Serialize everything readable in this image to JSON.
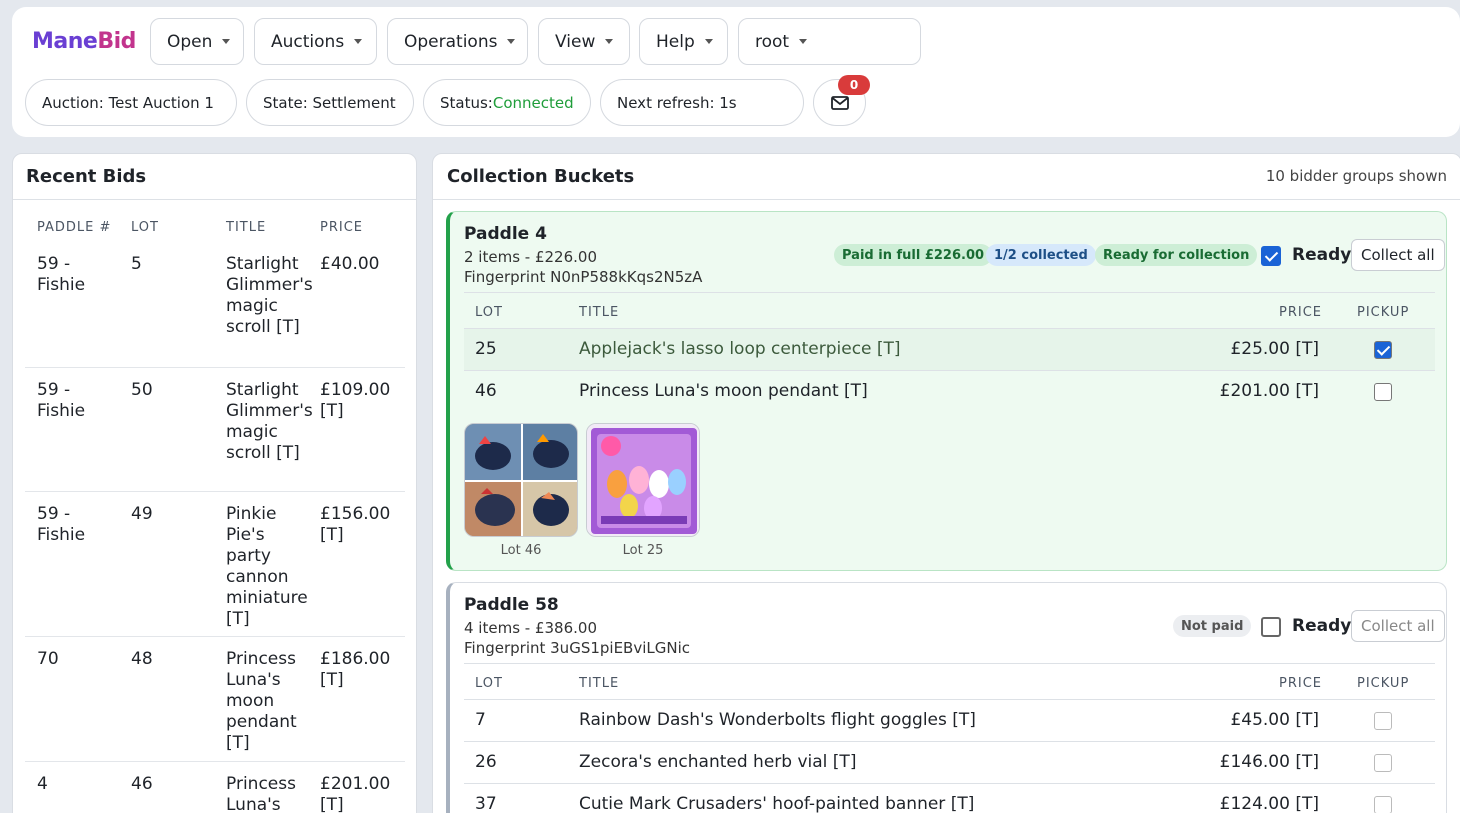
{
  "app": {
    "logo": {
      "part1": "Mane",
      "part2": "Bid"
    },
    "menus": [
      "Open",
      "Auctions",
      "Operations",
      "View",
      "Help",
      "root"
    ],
    "status": {
      "auction": "Auction: Test Auction 1",
      "state": "State: Settlement",
      "status_label": "Status:",
      "status_value": "Connected",
      "next_refresh": "Next refresh: 1s",
      "mail_count": "0"
    }
  },
  "recent_bids": {
    "title": "Recent Bids",
    "columns": [
      "PADDLE #",
      "LOT",
      "TITLE",
      "PRICE"
    ],
    "rows": [
      {
        "paddle": "59 - Fishie",
        "lot": "5",
        "title": "Starlight Glimmer's magic scroll [T]",
        "price": "£40.00"
      },
      {
        "paddle": "59 - Fishie",
        "lot": "50",
        "title": "Starlight Glimmer's magic scroll [T]",
        "price": "£109.00 [T]"
      },
      {
        "paddle": "59 - Fishie",
        "lot": "49",
        "title": "Pinkie Pie's party cannon miniature [T]",
        "price": "£156.00 [T]"
      },
      {
        "paddle": "70",
        "lot": "48",
        "title": "Princess Luna's moon pendant [T]",
        "price": "£186.00 [T]"
      },
      {
        "paddle": "4",
        "lot": "46",
        "title": "Princess Luna's",
        "price": "£201.00 [T]"
      }
    ]
  },
  "collection": {
    "title": "Collection Buckets",
    "shown_count": "10 bidder groups shown",
    "columns": {
      "lot": "LOT",
      "title": "TITLE",
      "price": "PRICE",
      "pickup": "PICKUP"
    },
    "ready_label": "Ready",
    "collect_all_label": "Collect all",
    "buckets": [
      {
        "title": "Paddle 4",
        "summary": "2 items - £226.00",
        "fingerprint": "Fingerprint N0nP588kKqs2N5zA",
        "tags": [
          "Paid in full £226.00",
          "1/2 collected",
          "Ready for collection"
        ],
        "ready": true,
        "items": [
          {
            "lot": "25",
            "title": "Applejack's lasso loop centerpiece [T]",
            "price": "£25.00 [T]",
            "picked": true
          },
          {
            "lot": "46",
            "title": "Princess Luna's moon pendant [T]",
            "price": "£201.00 [T]",
            "picked": false
          }
        ],
        "thumbs": [
          "Lot 46",
          "Lot 25"
        ]
      },
      {
        "title": "Paddle 58",
        "summary": "4 items - £386.00",
        "fingerprint": "Fingerprint 3uGS1piEBviLGNic",
        "tags": [
          "Not paid"
        ],
        "ready": false,
        "items": [
          {
            "lot": "7",
            "title": "Rainbow Dash's Wonderbolts flight goggles [T]",
            "price": "£45.00 [T]",
            "picked": false
          },
          {
            "lot": "26",
            "title": "Zecora's enchanted herb vial [T]",
            "price": "£146.00 [T]",
            "picked": false
          },
          {
            "lot": "37",
            "title": "Cutie Mark Crusaders' hoof-painted banner [T]",
            "price": "£124.00 [T]",
            "picked": false
          }
        ]
      }
    ]
  }
}
